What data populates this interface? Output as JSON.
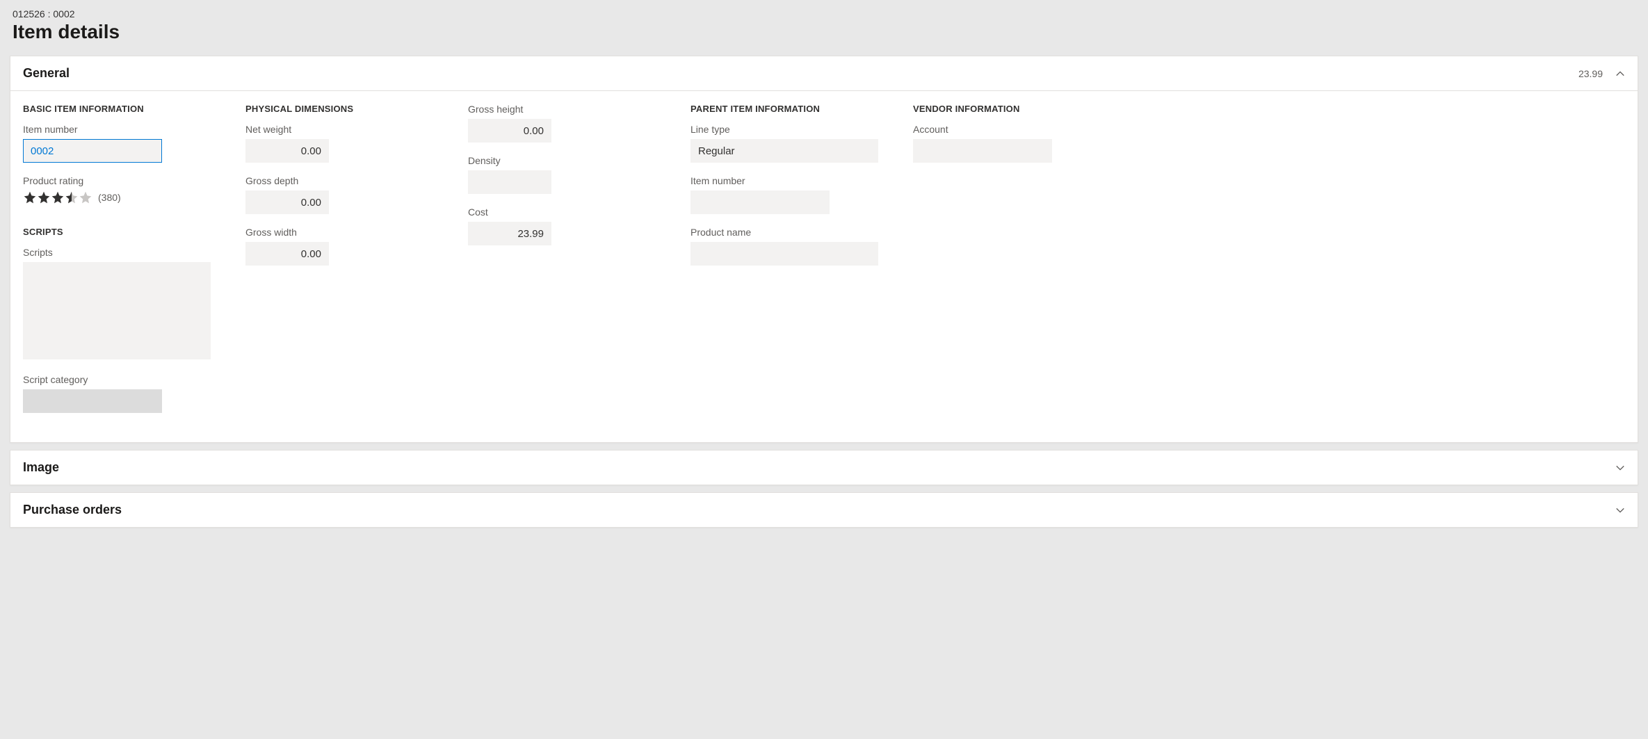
{
  "header": {
    "breadcrumb": "012526 : 0002",
    "title": "Item details"
  },
  "panels": {
    "general": {
      "title": "General",
      "summary": "23.99",
      "expanded": true
    },
    "image": {
      "title": "Image",
      "expanded": false
    },
    "purchase_orders": {
      "title": "Purchase orders",
      "expanded": false
    }
  },
  "groups": {
    "basic": {
      "heading": "BASIC ITEM INFORMATION",
      "item_number_label": "Item number",
      "item_number_value": "0002",
      "product_rating_label": "Product rating",
      "rating_value": 3.5,
      "rating_count": "(380)"
    },
    "scripts": {
      "heading": "SCRIPTS",
      "scripts_label": "Scripts",
      "scripts_value": "",
      "script_category_label": "Script category",
      "script_category_value": ""
    },
    "physical": {
      "heading": "PHYSICAL DIMENSIONS",
      "net_weight_label": "Net weight",
      "net_weight_value": "0.00",
      "gross_depth_label": "Gross depth",
      "gross_depth_value": "0.00",
      "gross_width_label": "Gross width",
      "gross_width_value": "0.00",
      "gross_height_label": "Gross height",
      "gross_height_value": "0.00",
      "density_label": "Density",
      "density_value": "",
      "cost_label": "Cost",
      "cost_value": "23.99"
    },
    "parent": {
      "heading": "PARENT ITEM INFORMATION",
      "line_type_label": "Line type",
      "line_type_value": "Regular",
      "item_number_label": "Item number",
      "item_number_value": "",
      "product_name_label": "Product name",
      "product_name_value": ""
    },
    "vendor": {
      "heading": "VENDOR INFORMATION",
      "account_label": "Account",
      "account_value": ""
    }
  }
}
